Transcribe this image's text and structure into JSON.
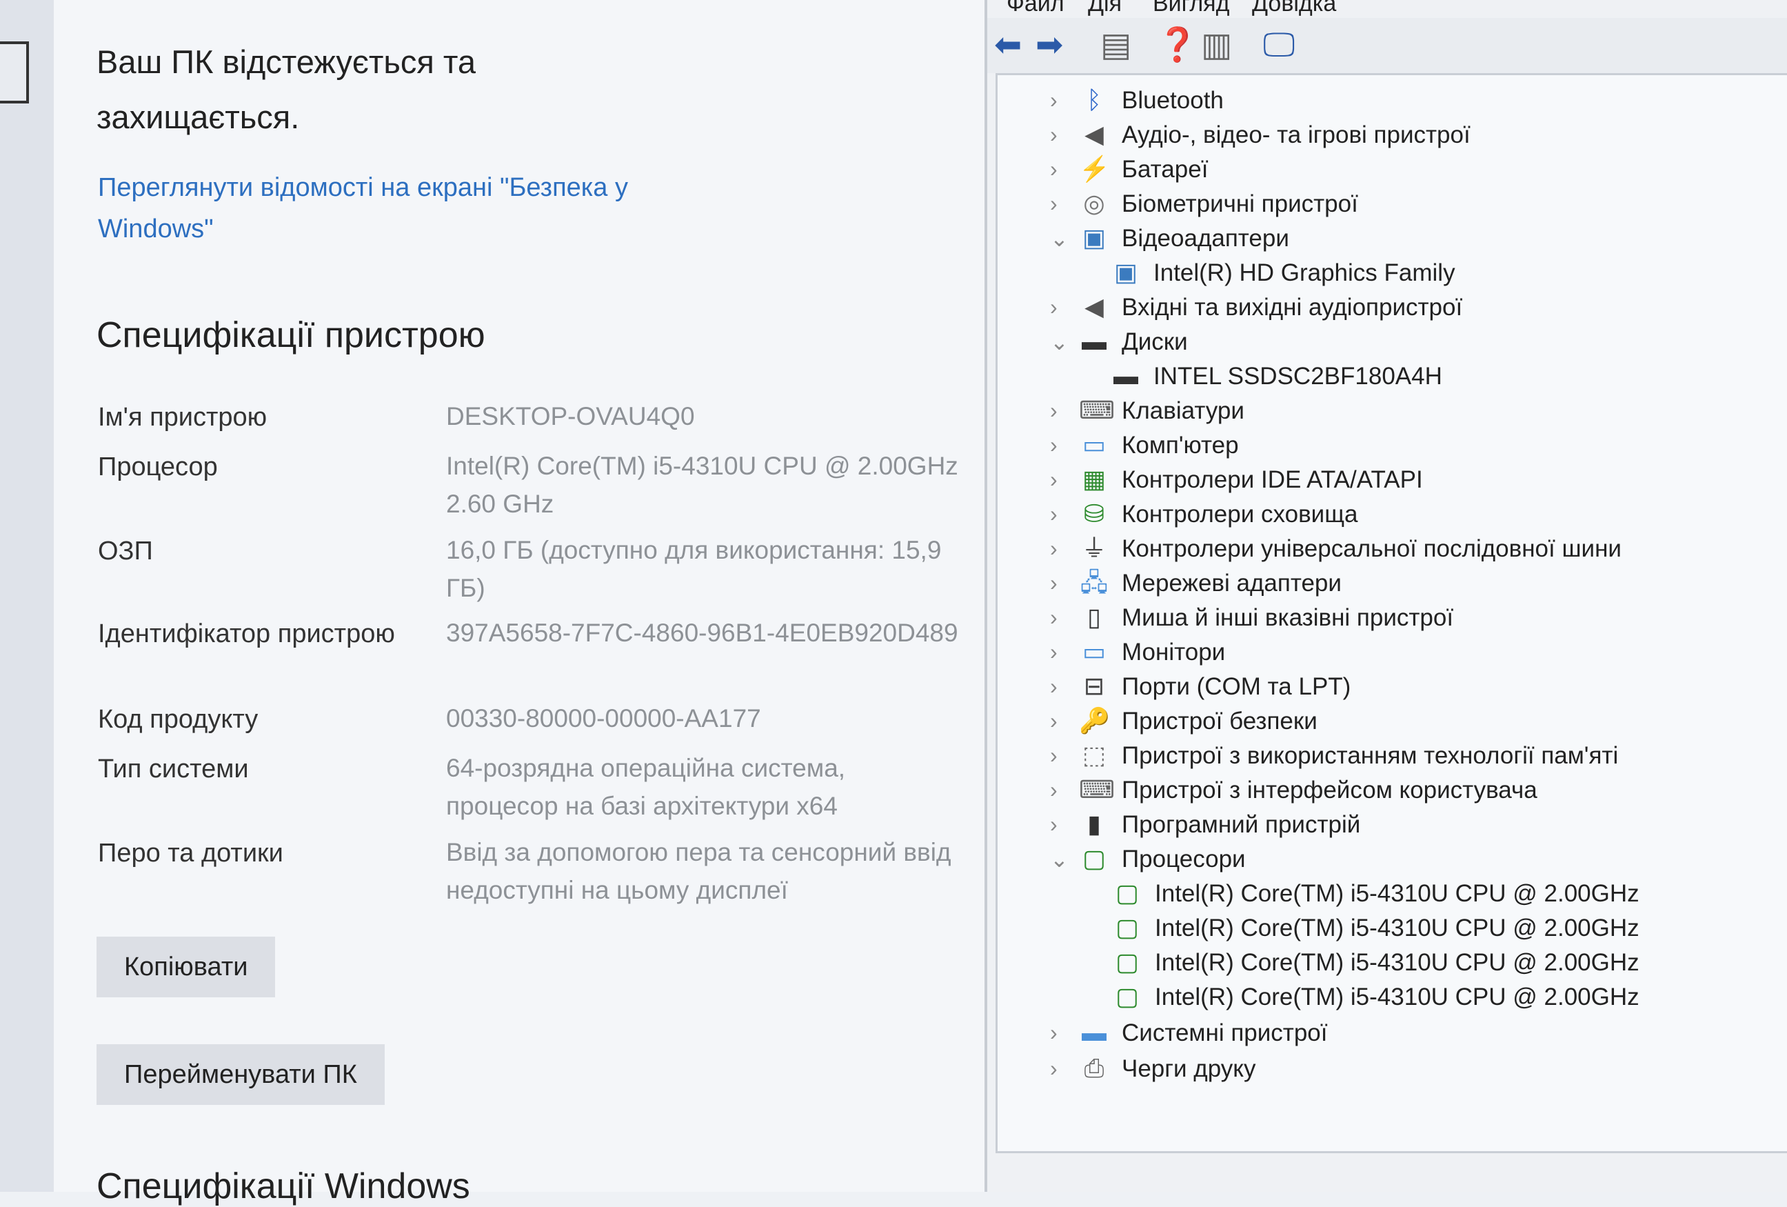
{
  "settings": {
    "protection_text": "Ваш ПК відстежується та захищається.",
    "security_link": "Переглянути відомості на екрані \"Безпека у Windows\"",
    "specs_heading": "Специфікації пристрою",
    "specs": [
      {
        "label": "Ім'я пристрою",
        "value": "DESKTOP-OVAU4Q0"
      },
      {
        "label": "Процесор",
        "value": "Intel(R) Core(TM) i5-4310U CPU @ 2.00GHz   2.60 GHz"
      },
      {
        "label": "ОЗП",
        "value": "16,0 ГБ (доступно для використання: 15,9 ГБ)"
      },
      {
        "label": "Ідентифікатор пристрою",
        "value": "397A5658-7F7C-4860-96B1-4E0EB920D489"
      },
      {
        "label": "Код продукту",
        "value": "00330-80000-00000-AA177"
      },
      {
        "label": "Тип системи",
        "value": "64-розрядна операційна система, процесор на базі архітектури x64"
      },
      {
        "label": "Перо та дотики",
        "value": "Ввід за допомогою пера та сенсорний ввід недоступні на цьому дисплеї"
      }
    ],
    "copy_button": "Копіювати",
    "rename_button": "Перейменувати ПК",
    "windows_heading": "Специфікації Windows"
  },
  "device_manager": {
    "menu": [
      "Файл",
      "Дія",
      "Вигляд",
      "Довідка"
    ],
    "toolbar_icons": [
      "back-arrow-icon",
      "forward-arrow-icon",
      "properties-icon",
      "help-icon",
      "show-hide-icon",
      "monitor-icon"
    ],
    "tree": [
      {
        "label": "Bluetooth",
        "expanded": false,
        "icon": "bluetooth-icon"
      },
      {
        "label": "Аудіо-, відео- та ігрові пристрої",
        "expanded": false,
        "icon": "speaker-icon"
      },
      {
        "label": "Батареї",
        "expanded": false,
        "icon": "battery-icon"
      },
      {
        "label": "Біометричні пристрої",
        "expanded": false,
        "icon": "fingerprint-icon"
      },
      {
        "label": "Відеоадаптери",
        "expanded": true,
        "icon": "display-adapter-icon",
        "children": [
          {
            "label": "Intel(R) HD Graphics Family",
            "icon": "display-adapter-icon"
          }
        ]
      },
      {
        "label": "Вхідні та вихідні аудіопристрої",
        "expanded": false,
        "icon": "speaker-icon"
      },
      {
        "label": "Диски",
        "expanded": true,
        "icon": "disk-icon",
        "children": [
          {
            "label": "INTEL SSDSC2BF180A4H",
            "icon": "disk-icon"
          }
        ]
      },
      {
        "label": "Клавіатури",
        "expanded": false,
        "icon": "keyboard-icon"
      },
      {
        "label": "Комп'ютер",
        "expanded": false,
        "icon": "computer-icon"
      },
      {
        "label": "Контролери IDE ATA/ATAPI",
        "expanded": false,
        "icon": "ide-controller-icon"
      },
      {
        "label": "Контролери сховища",
        "expanded": false,
        "icon": "storage-controller-icon"
      },
      {
        "label": "Контролери універсальної послідовної шини",
        "expanded": false,
        "icon": "usb-icon"
      },
      {
        "label": "Мережеві адаптери",
        "expanded": false,
        "icon": "network-adapter-icon"
      },
      {
        "label": "Миша й інші вказівні пристрої",
        "expanded": false,
        "icon": "mouse-icon"
      },
      {
        "label": "Монітори",
        "expanded": false,
        "icon": "monitor-icon"
      },
      {
        "label": "Порти (COM та LPT)",
        "expanded": false,
        "icon": "port-icon"
      },
      {
        "label": "Пристрої безпеки",
        "expanded": false,
        "icon": "security-device-icon"
      },
      {
        "label": "Пристрої з використанням технології пам'яті",
        "expanded": false,
        "icon": "memory-device-icon"
      },
      {
        "label": "Пристрої з інтерфейсом користувача",
        "expanded": false,
        "icon": "hid-icon"
      },
      {
        "label": "Програмний пристрій",
        "expanded": false,
        "icon": "software-device-icon"
      },
      {
        "label": "Процесори",
        "expanded": true,
        "icon": "processor-icon",
        "children": [
          {
            "label": "Intel(R) Core(TM) i5-4310U CPU @ 2.00GHz",
            "icon": "processor-icon"
          },
          {
            "label": "Intel(R) Core(TM) i5-4310U CPU @ 2.00GHz",
            "icon": "processor-icon"
          },
          {
            "label": "Intel(R) Core(TM) i5-4310U CPU @ 2.00GHz",
            "icon": "processor-icon"
          },
          {
            "label": "Intel(R) Core(TM) i5-4310U CPU @ 2.00GHz",
            "icon": "processor-icon"
          }
        ]
      },
      {
        "label": "Системні пристрої",
        "expanded": false,
        "icon": "system-devices-icon"
      },
      {
        "label": "Черги друку",
        "expanded": false,
        "icon": "printer-icon"
      }
    ]
  },
  "colors": {
    "link": "#2d6fc0",
    "value_text": "#8d9196",
    "button_bg": "#dcdfe5"
  }
}
